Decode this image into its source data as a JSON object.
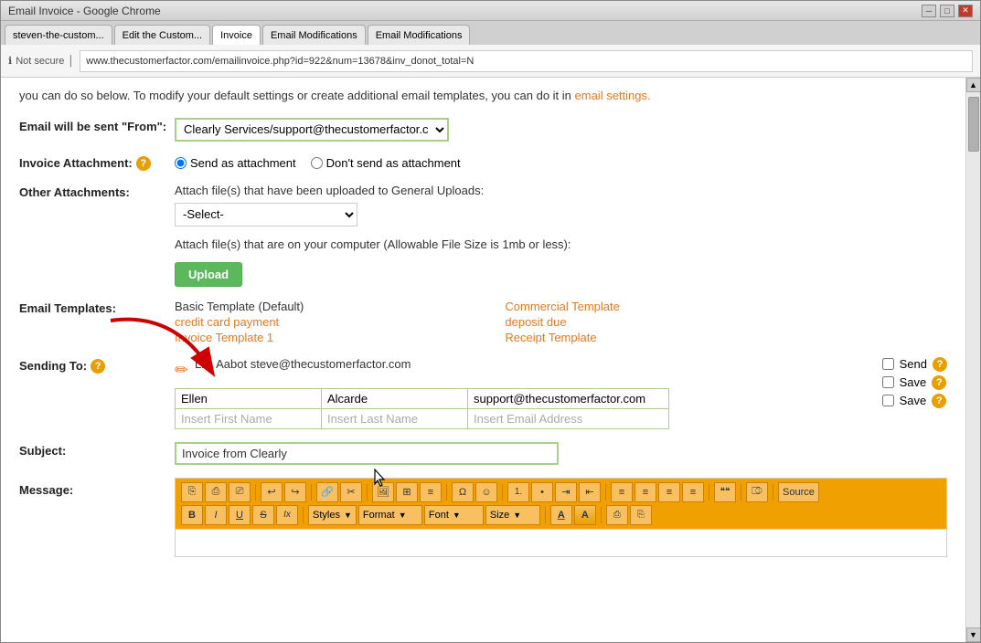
{
  "window": {
    "title": "Email Invoice - Google Chrome",
    "url": "www.thecustomerfactor.com/emailinvoice.php?id=922&num=13678&inv_donot_total=N"
  },
  "tabs": [
    {
      "label": "steven-the-custom...",
      "active": false
    },
    {
      "label": "Edit the Custom...",
      "active": false
    },
    {
      "label": "Invoice",
      "active": true
    },
    {
      "label": "Email Modifications",
      "active": false
    },
    {
      "label": "Email Modifications",
      "active": false
    }
  ],
  "security": {
    "label": "Not secure"
  },
  "page": {
    "intro_text": "you can do so below. To modify your default settings or create additional email templates, you can do it in",
    "email_settings_link": "email settings.",
    "from_label": "Email will be sent \"From\":",
    "from_value": "Clearly Services/support@thecustomerfactor.c",
    "invoice_attachment_label": "Invoice Attachment:",
    "send_as_attachment": "Send as attachment",
    "dont_send_attachment": "Don't send as attachment",
    "other_attachments_label": "Other Attachments:",
    "attach_upload_label": "Attach file(s) that have been uploaded to General Uploads:",
    "attach_select_default": "-Select-",
    "attach_computer_label": "Attach file(s) that are on your computer (Allowable File Size is 1mb or less):",
    "upload_button": "Upload",
    "email_templates_label": "Email Templates:",
    "templates": {
      "left": [
        {
          "label": "Basic Template (Default)",
          "link": false
        },
        {
          "label": "credit card payment",
          "link": true
        },
        {
          "label": "Invoice Template 1",
          "link": true
        }
      ],
      "right": [
        {
          "label": "Commercial Template",
          "link": true
        },
        {
          "label": "deposit due",
          "link": true
        },
        {
          "label": "Receipt Template",
          "link": true
        }
      ]
    },
    "sending_to_label": "Sending To:",
    "recipient_name": "Lila Aabot steve@thecustomerfactor.com",
    "recipients": [
      {
        "first": "Ellen",
        "last": "Alcarde",
        "email": "support@thecustomerfactor.com"
      }
    ],
    "placeholder_first": "Insert First Name",
    "placeholder_last": "Insert Last Name",
    "placeholder_email": "Insert Email Address",
    "send_label": "Send",
    "save_labels": [
      "Save",
      "Save"
    ],
    "subject_label": "Subject:",
    "subject_value": "Invoice from Clearly",
    "message_label": "Message:",
    "toolbar": {
      "row1_buttons": [
        "⎘",
        "⎙",
        "⎚",
        "↩",
        "↪",
        "🔗",
        "✂",
        "🖼",
        "⊞",
        "≡",
        "Ω",
        "☺",
        "1.",
        "•",
        "⇥",
        "⇤",
        "≡",
        "≡",
        "≡",
        "≡",
        "❝❝",
        "⎄",
        "Source"
      ],
      "row2_buttons": [
        "B",
        "I",
        "U",
        "S",
        "Ix"
      ],
      "row2_dropdowns": [
        "Styles",
        "Format",
        "Font",
        "Size"
      ],
      "color_buttons": [
        "A",
        "A",
        "⎙",
        "⎘"
      ]
    }
  }
}
